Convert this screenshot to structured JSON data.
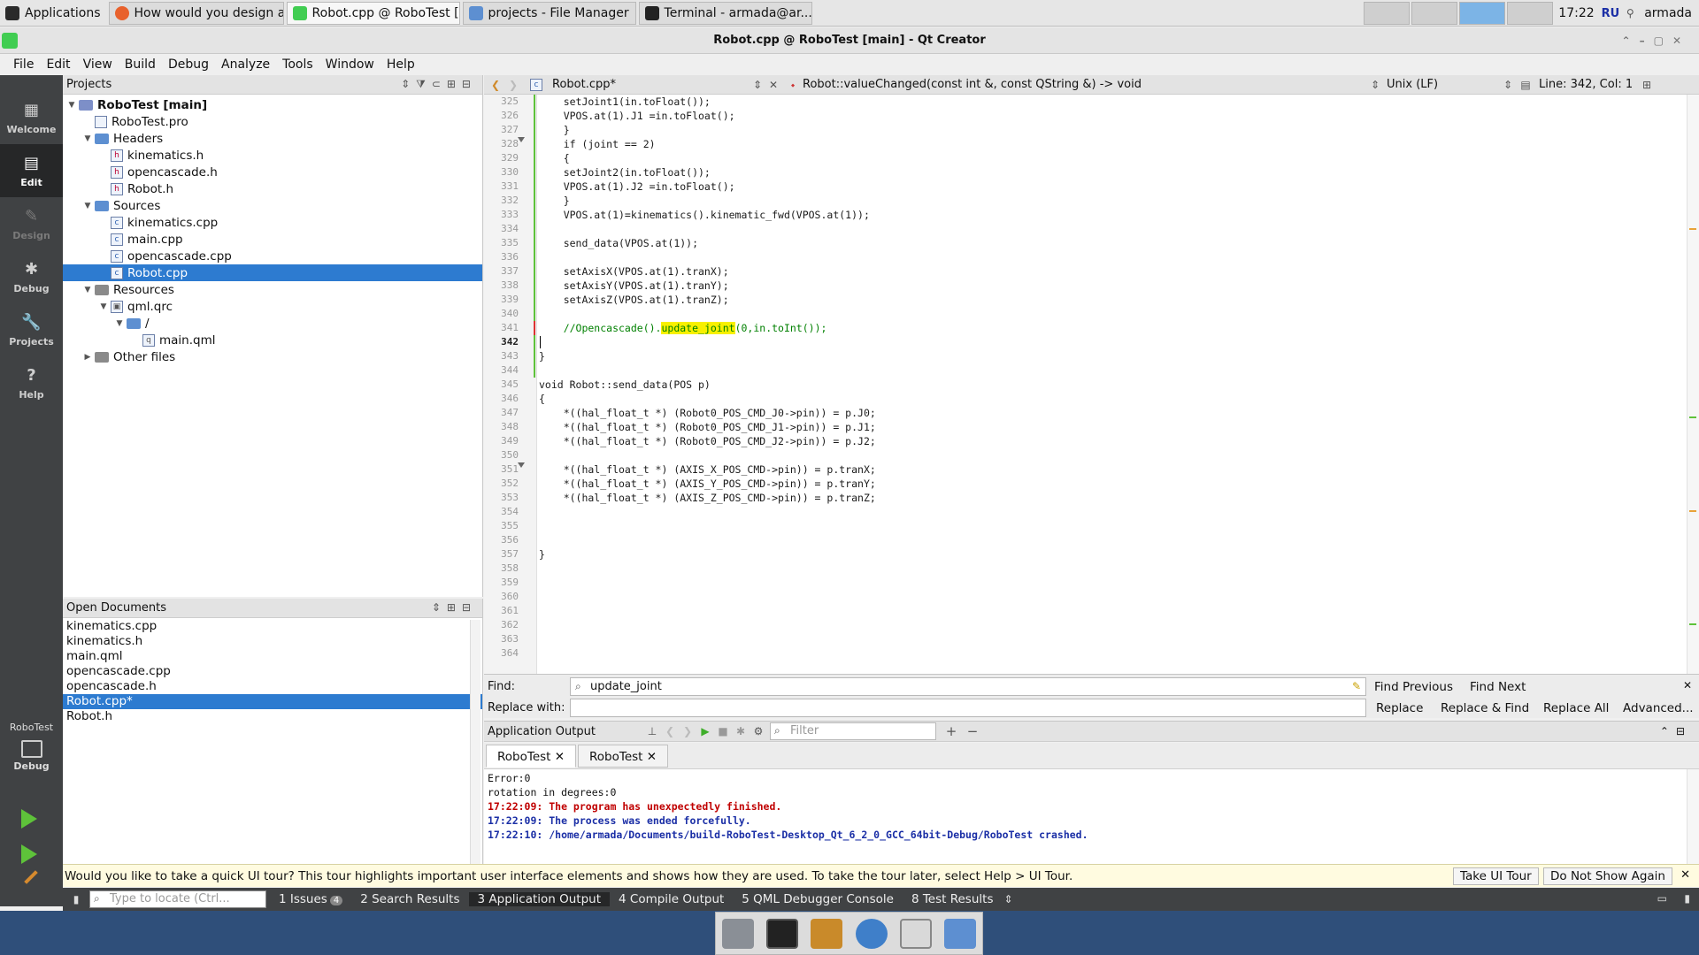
{
  "taskbar": {
    "apps_label": "Applications",
    "windows": [
      {
        "title": "How would you design a..."
      },
      {
        "title": "Robot.cpp @ RoboTest [..."
      },
      {
        "title": "projects - File Manager"
      },
      {
        "title": "Terminal - armada@ar..."
      }
    ],
    "clock": "17:22",
    "keyboard_layout": "RU",
    "user": "armada"
  },
  "window": {
    "title": "Robot.cpp @ RoboTest [main] - Qt Creator"
  },
  "menu": [
    "File",
    "Edit",
    "View",
    "Build",
    "Debug",
    "Analyze",
    "Tools",
    "Window",
    "Help"
  ],
  "modes": [
    {
      "label": "Welcome",
      "icon": "grid-icon"
    },
    {
      "label": "Edit",
      "icon": "document-icon"
    },
    {
      "label": "Design",
      "icon": "pencil-icon"
    },
    {
      "label": "Debug",
      "icon": "bug-icon"
    },
    {
      "label": "Projects",
      "icon": "wrench-icon"
    },
    {
      "label": "Help",
      "icon": "question-icon"
    }
  ],
  "kit": {
    "project": "RoboTest",
    "mode": "Debug"
  },
  "projects": {
    "header": "Projects",
    "tree": [
      {
        "label": "RoboTest [main]"
      },
      {
        "label": "RoboTest.pro"
      },
      {
        "label": "Headers"
      },
      {
        "label": "kinematics.h"
      },
      {
        "label": "opencascade.h"
      },
      {
        "label": "Robot.h"
      },
      {
        "label": "Sources"
      },
      {
        "label": "kinematics.cpp"
      },
      {
        "label": "main.cpp"
      },
      {
        "label": "opencascade.cpp"
      },
      {
        "label": "Robot.cpp"
      },
      {
        "label": "Resources"
      },
      {
        "label": "qml.qrc"
      },
      {
        "label": "/"
      },
      {
        "label": "main.qml"
      },
      {
        "label": "Other files"
      }
    ]
  },
  "open_documents": {
    "header": "Open Documents",
    "items": [
      "kinematics.cpp",
      "kinematics.h",
      "main.qml",
      "opencascade.cpp",
      "opencascade.h",
      "Robot.cpp*",
      "Robot.h"
    ]
  },
  "editor": {
    "file": "Robot.cpp*",
    "function": "Robot::valueChanged(const int &, const QString &) -> void",
    "line_ending": "Unix (LF)",
    "position": "Line: 342, Col: 1",
    "line_numbers": [
      "325",
      "326",
      "327",
      "328",
      "329",
      "330",
      "331",
      "332",
      "333",
      "334",
      "335",
      "336",
      "337",
      "338",
      "339",
      "340",
      "341",
      "342",
      "343",
      "344",
      "345",
      "346",
      "347",
      "348",
      "349",
      "350",
      "351",
      "352",
      "353",
      "354",
      "355",
      "356",
      "357",
      "358",
      "359",
      "360",
      "361",
      "362",
      "363",
      "364"
    ],
    "lines": [
      "    setJoint1(in.toFloat());",
      "    VPOS.at(1).J1 =in.toFloat();",
      "    }",
      "    if (joint == 2)",
      "    {",
      "    setJoint2(in.toFloat());",
      "    VPOS.at(1).J2 =in.toFloat();",
      "    }",
      "    VPOS.at(1)=kinematics().kinematic_fwd(VPOS.at(1));",
      "",
      "    send_data(VPOS.at(1));",
      "",
      "    setAxisX(VPOS.at(1).tranX);",
      "    setAxisY(VPOS.at(1).tranY);",
      "    setAxisZ(VPOS.at(1).tranZ);",
      "",
      "    //Opencascade().",
      "",
      "}",
      "",
      "void Robot::send_data(POS p)",
      "{",
      "    *((hal_float_t *) (Robot0_POS_CMD_J0->pin)) = p.J0;",
      "    *((hal_float_t *) (Robot0_POS_CMD_J1->pin)) = p.J1;",
      "    *((hal_float_t *) (Robot0_POS_CMD_J2->pin)) = p.J2;",
      "",
      "    *((hal_float_t *) (AXIS_X_POS_CMD->pin)) = p.tranX;",
      "    *((hal_float_t *) (AXIS_Y_POS_CMD->pin)) = p.tranY;",
      "    *((hal_float_t *) (AXIS_Z_POS_CMD->pin)) = p.tranZ;",
      "",
      "",
      "",
      "}",
      "",
      "",
      "",
      "",
      "",
      "",
      ""
    ],
    "highlight_word": "update_joint",
    "highlight_suffix": "(0,in.toInt());"
  },
  "find": {
    "find_label": "Find:",
    "find_value": "update_joint",
    "replace_label": "Replace with:",
    "replace_value": "",
    "find_previous": "Find Previous",
    "find_next": "Find Next",
    "replace": "Replace",
    "replace_find": "Replace & Find",
    "replace_all": "Replace All",
    "advanced": "Advanced..."
  },
  "output": {
    "header": "Application Output",
    "filter_placeholder": "Filter",
    "tabs": [
      "RoboTest",
      "RoboTest"
    ],
    "lines": [
      {
        "text": "Error:0",
        "style": "normal"
      },
      {
        "text": "rotation in degrees:0",
        "style": "normal"
      },
      {
        "text": "17:22:09: The program has unexpectedly finished.",
        "style": "red"
      },
      {
        "text": "17:22:09: The process was ended forcefully.",
        "style": "blue"
      },
      {
        "text": "17:22:10: /home/armada/Documents/build-RoboTest-Desktop_Qt_6_2_0_GCC_64bit-Debug/RoboTest crashed.",
        "style": "blue"
      }
    ]
  },
  "tour": {
    "message": "Would you like to take a quick UI tour? This tour highlights important user interface elements and shows how they are used. To take the tour later, select Help > UI Tour.",
    "take": "Take UI Tour",
    "dismiss": "Do Not Show Again"
  },
  "statusbar": {
    "locate_placeholder": "Type to locate (Ctrl...",
    "panes": [
      {
        "label": "1  Issues",
        "badge": "4"
      },
      {
        "label": "2  Search Results"
      },
      {
        "label": "3  Application Output"
      },
      {
        "label": "4  Compile Output"
      },
      {
        "label": "5  QML Debugger Console"
      },
      {
        "label": "8  Test Results"
      }
    ]
  },
  "colors": {
    "selection": "#2d7bd0",
    "sidebar": "#404244",
    "highlight": "#f8f000",
    "error_red": "#c00000",
    "info_blue": "#1b2fa6"
  }
}
